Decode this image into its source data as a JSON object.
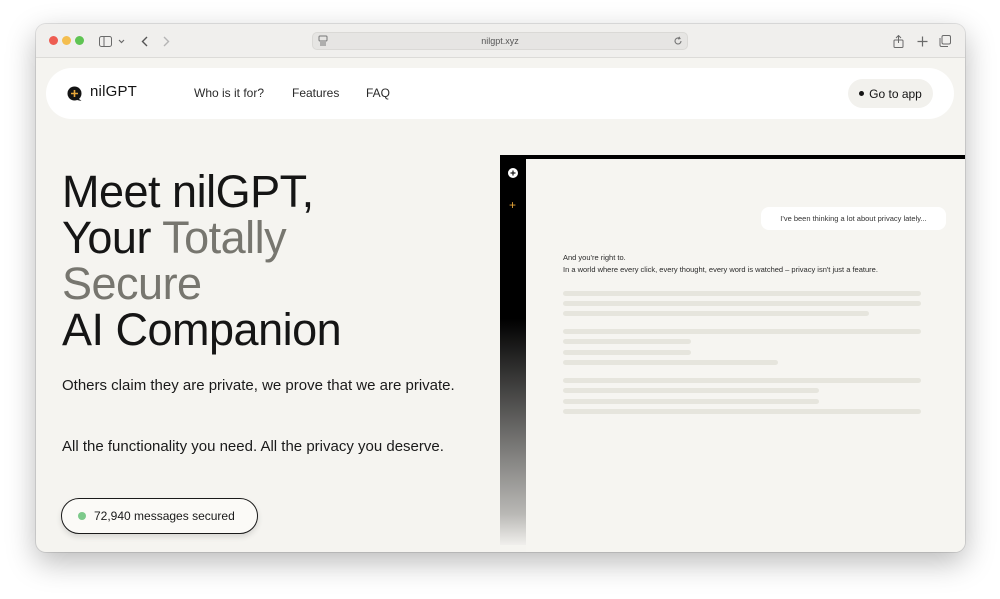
{
  "browser": {
    "url": "nilgpt.xyz",
    "icons": [
      "sidebar-icon",
      "chevron-down-icon",
      "back-icon",
      "forward-icon",
      "reload-icon",
      "share-icon",
      "new-tab-icon",
      "tabs-overview-icon"
    ]
  },
  "nav": {
    "logo_text": "nilGPT",
    "links": [
      "Who is it for?",
      "Features",
      "FAQ"
    ],
    "cta_label": "Go to app"
  },
  "hero": {
    "line1": "Meet nilGPT,",
    "line2_a": "Your ",
    "line2_b": "Totally",
    "line3": "Secure",
    "line4": "AI Companion"
  },
  "body": {
    "paragraph1": "Others claim they are private, we prove that we are private.",
    "paragraph2": "All the functionality you need. All the privacy you deserve."
  },
  "counter": {
    "label": "72,940 messages secured",
    "status_color": "#7cc98a"
  },
  "mockup": {
    "user_message": "I've been thinking a lot about privacy lately...",
    "ai_line1": "And you're right to.",
    "ai_line2": "In a world where every click, every thought, every word is watched – privacy isn't just a feature."
  },
  "colors": {
    "accent": "#e8a73a",
    "background": "#f5f4f0",
    "muted_text": "#77766f"
  }
}
